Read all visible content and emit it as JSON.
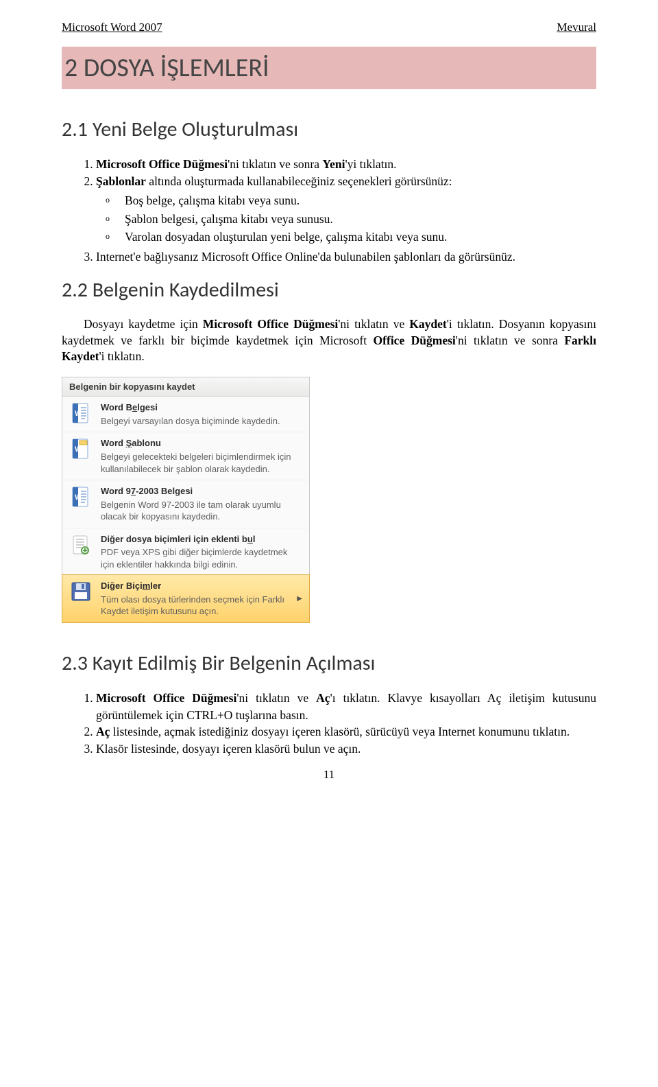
{
  "header": {
    "left": "Microsoft Word 2007",
    "right": "Mevural"
  },
  "chapter": {
    "title": "2 DOSYA İŞLEMLERİ"
  },
  "section21": {
    "title": "2.1 Yeni Belge Oluşturulması",
    "step1_a": "Microsoft Office Düğmesi",
    "step1_b": "'ni tıklatın ve sonra ",
    "step1_c": "Yeni",
    "step1_d": "'yi tıklatın.",
    "step2_a": "Şablonlar",
    "step2_b": " altında oluşturmada kullanabileceğiniz seçenekleri görürsünüz:",
    "sub1": "Boş belge, çalışma kitabı veya sunu.",
    "sub2": "Şablon belgesi, çalışma kitabı veya sunusu.",
    "sub3": "Varolan dosyadan oluşturulan yeni belge, çalışma kitabı veya sunu.",
    "step3": "Internet'e bağlıysanız Microsoft Office Online'da bulunabilen şablonları da görürsünüz."
  },
  "section22": {
    "title": "2.2 Belgenin Kaydedilmesi",
    "p_a": "Dosyayı kaydetme için ",
    "p_b": "Microsoft Office Düğmesi",
    "p_c": "'ni tıklatın ve ",
    "p_d": "Kaydet",
    "p_e": "'i tıklatın. Dosyanın kopyasını kaydetmek ve farklı bir biçimde kaydetmek için Microsoft ",
    "p_f": "Office Düğmesi",
    "p_g": "'ni tıklatın ve sonra ",
    "p_h": "Farklı Kaydet",
    "p_i": "'i tıklatın."
  },
  "menu": {
    "header": "Belgenin bir kopyasını kaydet",
    "items": [
      {
        "title_pre": "Word B",
        "title_ul": "e",
        "title_post": "lgesi",
        "desc": "Belgeyi varsayılan dosya biçiminde kaydedin.",
        "icon": "word"
      },
      {
        "title_pre": "Word ",
        "title_ul": "Ş",
        "title_post": "ablonu",
        "desc": "Belgeyi gelecekteki belgeleri biçimlendirmek için kullanılabilecek bir şablon olarak kaydedin.",
        "icon": "word"
      },
      {
        "title_pre": "Word 9",
        "title_ul": "7",
        "title_post": "-2003 Belgesi",
        "desc": "Belgenin Word 97-2003 ile tam olarak uyumlu olacak bir kopyasını kaydedin.",
        "icon": "word"
      },
      {
        "title_pre": "Diğer dosya biçimleri için eklenti b",
        "title_ul": "u",
        "title_post": "l",
        "desc": "PDF veya XPS gibi diğer biçimlerde kaydetmek için eklentiler hakkında bilgi edinin.",
        "icon": "addin"
      },
      {
        "title_pre": "Diğer Biçi",
        "title_ul": "m",
        "title_post": "ler",
        "desc": "Tüm olası dosya türlerinden seçmek için Farklı Kaydet iletişim kutusunu açın.",
        "icon": "saveas"
      }
    ]
  },
  "section23": {
    "title": "2.3 Kayıt Edilmiş Bir Belgenin Açılması",
    "s1_a": "Microsoft Office Düğmesi",
    "s1_b": "'ni tıklatın ve ",
    "s1_c": "Aç",
    "s1_d": "'ı tıklatın. Klavye kısayolları  Aç iletişim kutusunu görüntülemek için CTRL+O tuşlarına basın.",
    "s2_a": "Aç",
    "s2_b": " listesinde, açmak istediğiniz dosyayı içeren klasörü, sürücüyü veya Internet konumunu tıklatın.",
    "s3": "Klasör listesinde, dosyayı içeren klasörü bulun ve açın."
  },
  "page_number": "11"
}
